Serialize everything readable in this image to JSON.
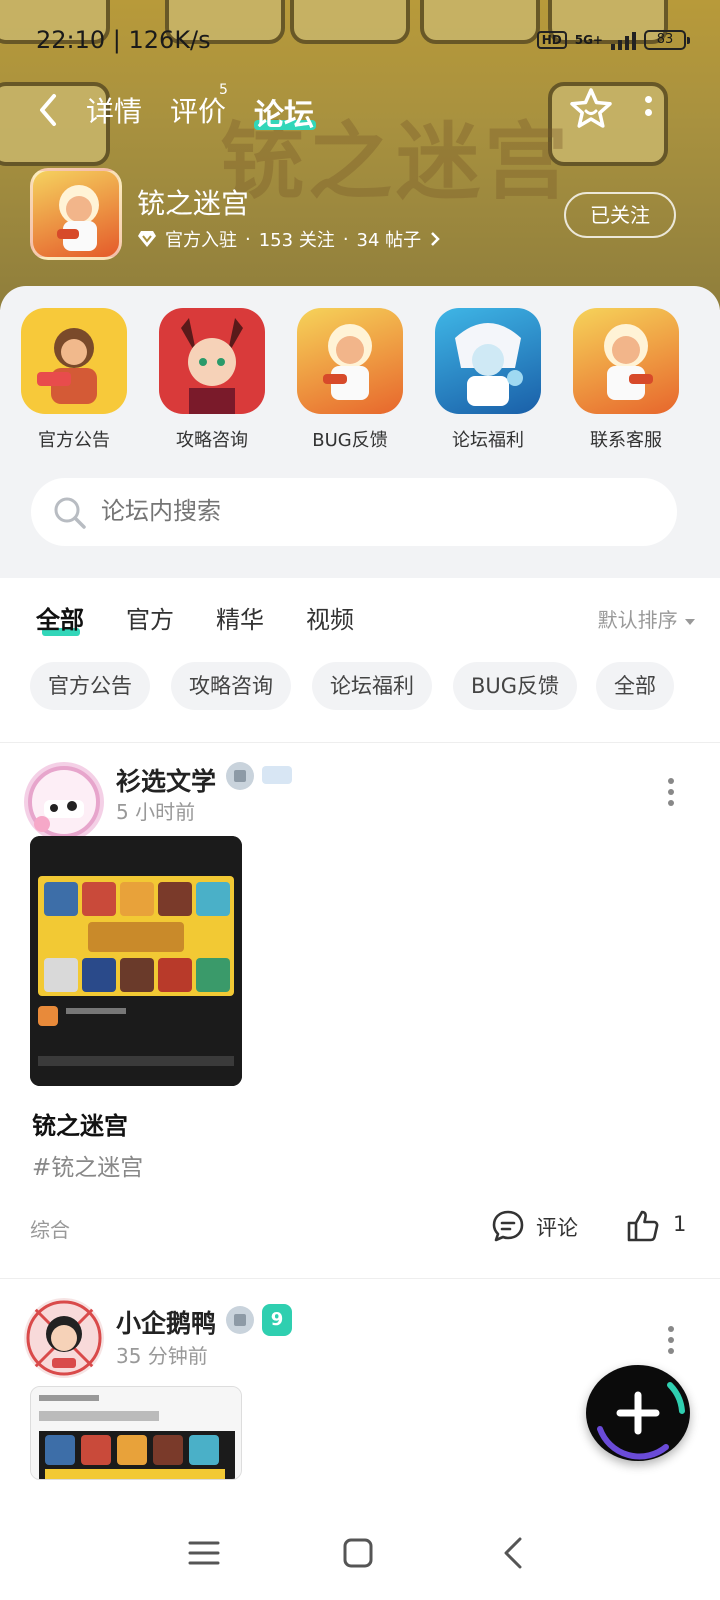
{
  "status": {
    "time": "22:10 | 126K/s",
    "hd": "HD",
    "network": "5G+",
    "battery": "83"
  },
  "header": {
    "tabs": [
      "详情",
      "评价",
      "论坛"
    ],
    "review_badge": "5",
    "banner_watermark": "铳之迷宫",
    "game_name": "铳之迷宫",
    "official_label": "官方入驻",
    "follow_count": "153 关注",
    "post_count": "34 帖子",
    "dot": "·",
    "follow_button": "已关注"
  },
  "quick_links": [
    {
      "label": "官方公告"
    },
    {
      "label": "攻略咨询"
    },
    {
      "label": "BUG反馈"
    },
    {
      "label": "论坛福利"
    },
    {
      "label": "联系客服"
    }
  ],
  "search": {
    "placeholder": "论坛内搜索"
  },
  "filter_tabs": [
    "全部",
    "官方",
    "精华",
    "视频"
  ],
  "sort_label": "默认排序",
  "chips": [
    "官方公告",
    "攻略咨询",
    "论坛福利",
    "BUG反馈",
    "全部"
  ],
  "posts": [
    {
      "author": "衫选文学",
      "time": "5 小时前",
      "title": "铳之迷宫",
      "tag": "#铳之迷宫",
      "category": "综合",
      "comment_label": "评论",
      "likes": "1"
    },
    {
      "author": "小企鹅鸭",
      "time": "35 分钟前",
      "level": "9"
    }
  ],
  "colors": {
    "accent": "#32d6b9",
    "banner": "#b89a3a",
    "bg": "#f2f3f5"
  },
  "icons": [
    "back-icon",
    "star-icon",
    "more-icon",
    "search-icon",
    "comment-icon",
    "like-icon",
    "plus-icon",
    "menu-icon",
    "home-icon",
    "nav-back-icon"
  ]
}
